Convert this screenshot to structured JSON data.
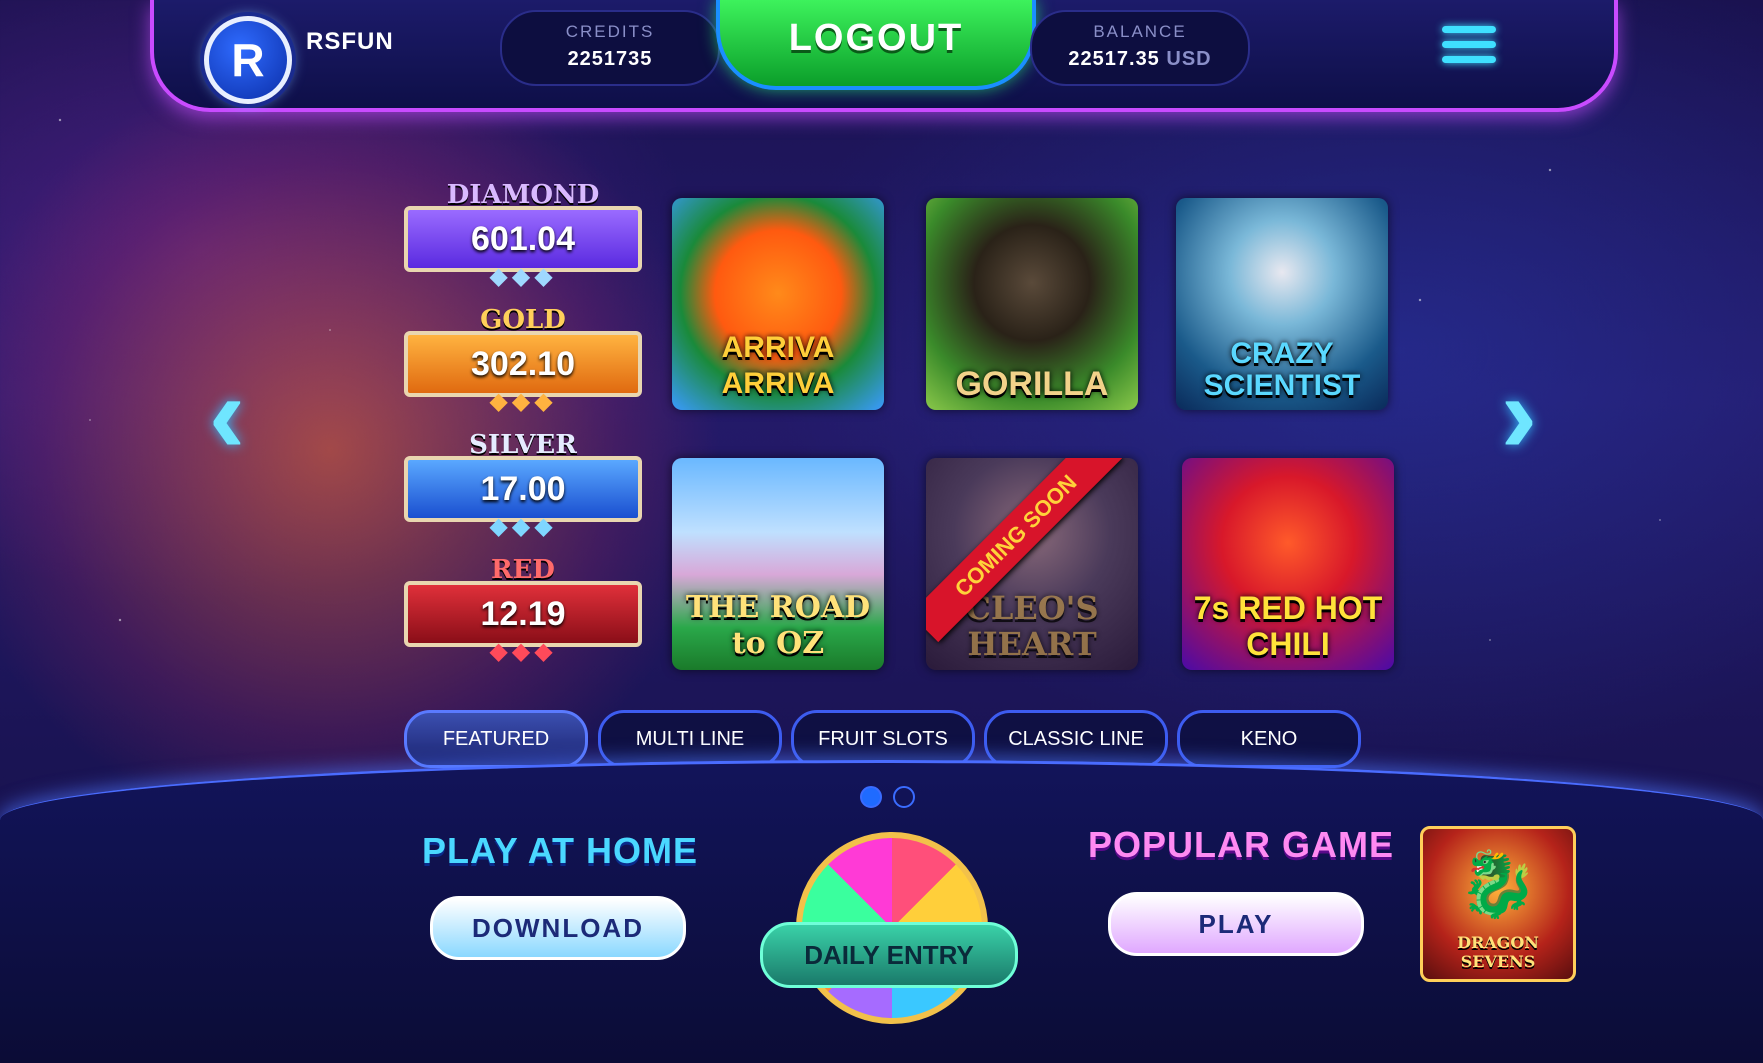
{
  "header": {
    "avatar_letter": "R",
    "username": "RSFUN",
    "credits_label": "CREDITS",
    "credits_value": "2251735",
    "logout_label": "LOGOUT",
    "balance_label": "BALANCE",
    "balance_value": "22517.35",
    "balance_currency": "USD"
  },
  "jackpots": [
    {
      "name": "DIAMOND",
      "value": "601.04"
    },
    {
      "name": "GOLD",
      "value": "302.10"
    },
    {
      "name": "SILVER",
      "value": "17.00"
    },
    {
      "name": "RED",
      "value": "12.19"
    }
  ],
  "games": [
    {
      "title": "ARRIVA ARRIVA"
    },
    {
      "title": "GORILLA"
    },
    {
      "title": "CRAZY SCIENTIST"
    },
    {
      "title": "THE ROAD to OZ"
    },
    {
      "title": "CLEO'S HEART",
      "ribbon": "COMING SOON"
    },
    {
      "title": "7s RED HOT CHILI"
    }
  ],
  "tabs": [
    "FEATURED",
    "MULTI LINE",
    "FRUIT SLOTS",
    "CLASSIC LINE",
    "KENO"
  ],
  "active_tab": "FEATURED",
  "pagination": {
    "current": 1,
    "total": 2
  },
  "bottom": {
    "play_home_title": "PLAY AT HOME",
    "download_label": "DOWNLOAD",
    "daily_entry_label": "DAILY ENTRY",
    "popular_title": "POPULAR GAME",
    "play_label": "PLAY",
    "popular_game_name": "DRAGON SEVENS"
  },
  "icons": {
    "prev": "chevron-left-icon",
    "next": "chevron-right-icon",
    "menu": "hamburger-menu-icon"
  },
  "colors": {
    "accent": "#c94bff",
    "logout": "#2bd648",
    "tab_border": "#3d5cf0"
  }
}
